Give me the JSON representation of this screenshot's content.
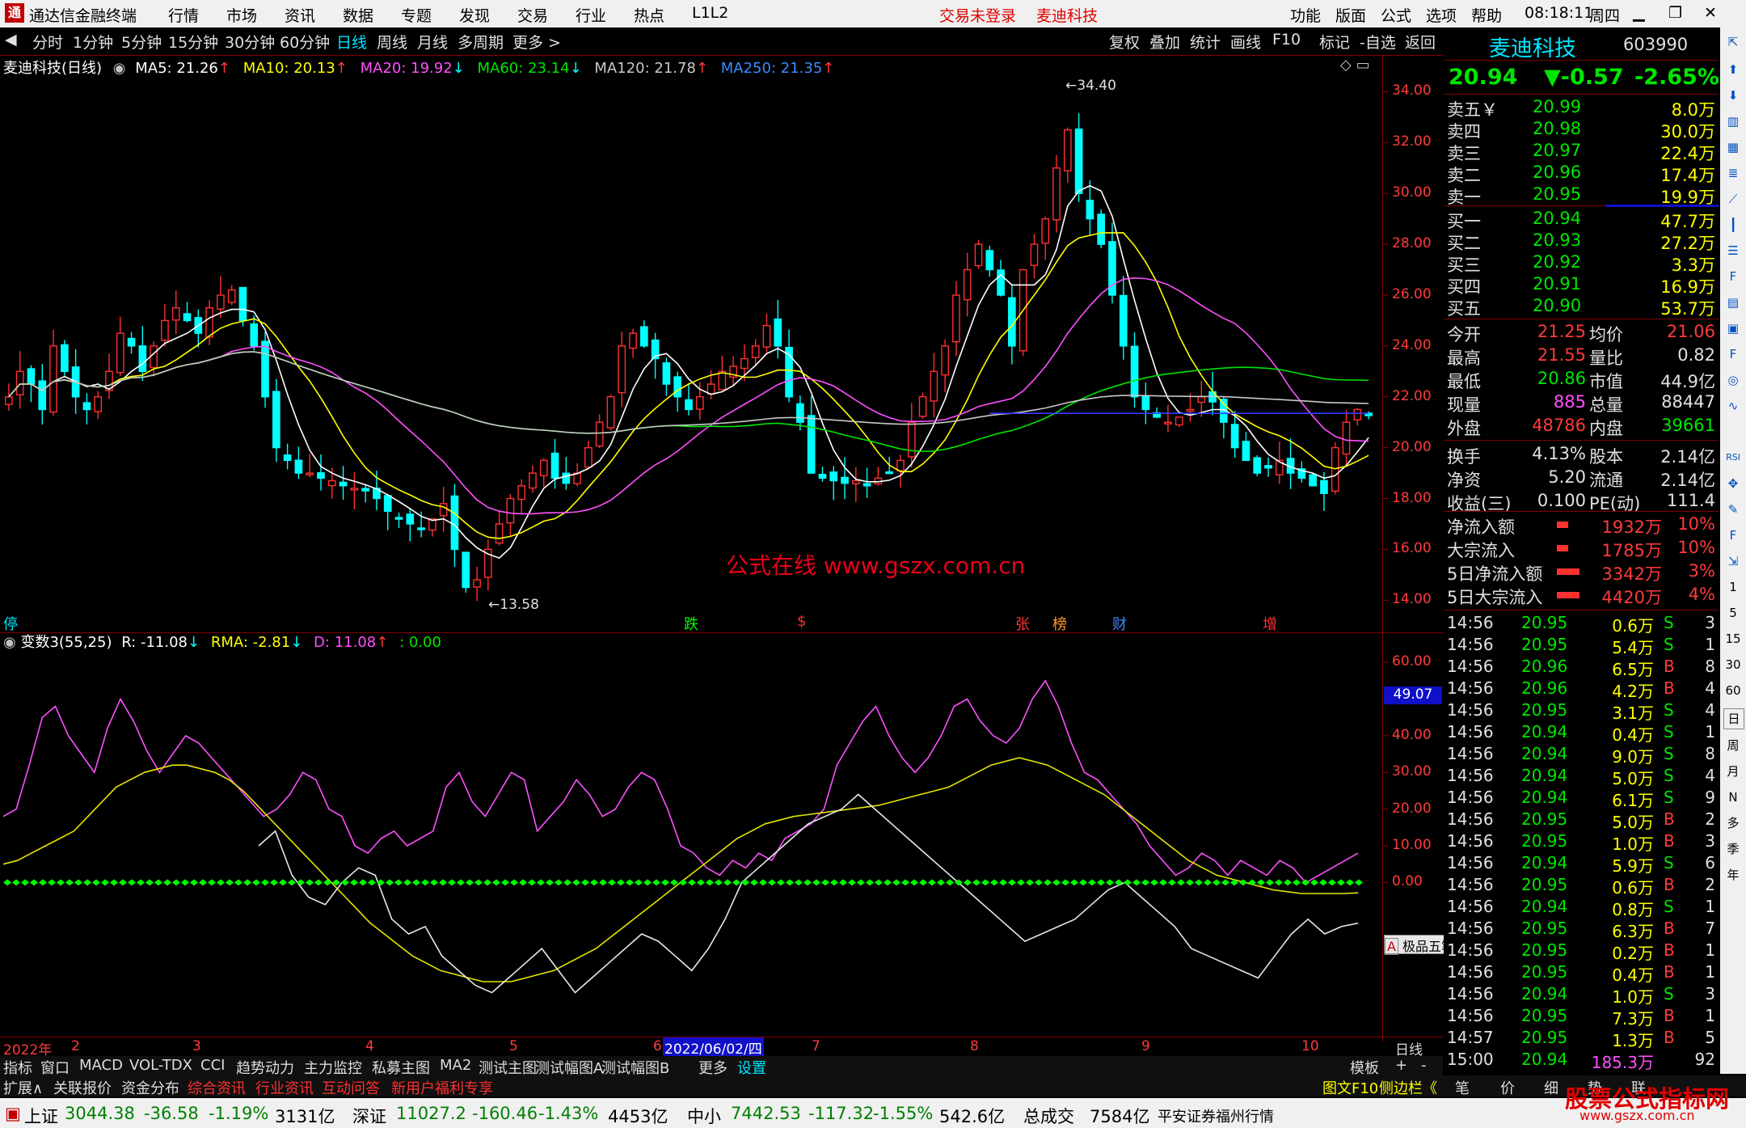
{
  "app": {
    "title": "通达信金融终端",
    "menu": [
      "行情",
      "市场",
      "资讯",
      "数据",
      "专题",
      "发现",
      "交易",
      "行业",
      "热点",
      "L1L2"
    ],
    "notice": [
      "交易未登录",
      "麦迪科技"
    ],
    "right_menu": [
      "功能",
      "版面",
      "公式",
      "选项",
      "帮助"
    ],
    "clock": "08:18:11",
    "weekday": "周四"
  },
  "toolbar": {
    "periods": [
      "分时",
      "1分钟",
      "5分钟",
      "15分钟",
      "30分钟",
      "60分钟",
      "日线",
      "周线",
      "月线",
      "多周期",
      "更多 >"
    ],
    "actions": [
      "复权",
      "叠加",
      "统计",
      "画线",
      "F10",
      "标记",
      "-自选",
      "返回"
    ]
  },
  "ma_header": {
    "name": "麦迪科技(日线)",
    "ma5": "MA5: 21.26",
    "ma10": "MA10: 20.13",
    "ma20": "MA20: 19.92",
    "ma60": "MA60: 23.14",
    "ma120": "MA120: 21.78",
    "ma250": "MA250: 21.35"
  },
  "indicator_header": {
    "name": "变数3(55,25)",
    "r": "R: -11.08",
    "rma": "RMA: -2.81",
    "d": "D: 11.08",
    "z": ": 0.00"
  },
  "watermark": "公式在线 www.gszx.com.cn",
  "price_labels": {
    "high": "34.40",
    "low": "13.58"
  },
  "event_marks": [
    "停",
    "跌",
    "$",
    "张",
    "榜",
    "财",
    "增"
  ],
  "date_axis": {
    "year": "2022年",
    "months": [
      "2",
      "3",
      "4",
      "5",
      "6",
      "7",
      "8",
      "9",
      "10"
    ],
    "cursor": "2022/06/02/四",
    "period": "日线"
  },
  "float_toolbar": "极品五笔",
  "chart_data": [
    {
      "type": "candlestick",
      "y_axis": [
        "34.00",
        "32.00",
        "30.00",
        "28.00",
        "26.00",
        "24.00",
        "22.00",
        "20.00",
        "18.00",
        "16.00",
        "14.00"
      ],
      "ylim": [
        13.5,
        35.0
      ],
      "close": [
        22,
        23,
        22.5,
        21.5,
        24,
        23,
        22,
        21.5,
        22,
        23,
        24.5,
        24,
        23,
        24,
        25,
        25.5,
        25,
        24.5,
        25.5,
        26,
        26.2,
        25,
        24,
        22,
        20,
        19.5,
        19,
        19,
        18.8,
        18.7,
        18.5,
        18.4,
        18.3,
        18,
        17.5,
        17.2,
        17,
        16.8,
        17.2,
        17.8,
        16,
        14.5,
        14.8,
        16,
        17,
        18,
        18.5,
        19,
        19.5,
        18.8,
        18.6,
        19,
        20,
        21,
        22,
        24,
        24.5,
        24,
        23.5,
        22.5,
        22,
        21.5,
        22,
        22.5,
        23,
        23.2,
        23.5,
        24,
        24.8,
        24,
        22,
        21,
        19,
        18.8,
        18.7,
        18.6,
        18.7,
        18.5,
        18.8,
        19,
        19.5,
        21,
        22,
        23,
        24,
        26,
        27,
        28,
        27,
        26,
        24,
        27,
        28,
        29,
        31,
        32.5,
        30,
        29,
        28,
        26,
        24,
        22,
        21.5,
        21.2,
        21,
        21.2,
        21.5,
        22,
        21.8,
        21,
        20,
        19.5,
        19,
        19.2,
        19.5,
        19,
        18.8,
        18.5,
        18.2,
        20,
        21,
        21.5,
        21.26
      ],
      "ma5": "MA5",
      "ma10": "MA10",
      "ma20": "MA20",
      "ma60": "MA60",
      "ma120": "MA120"
    },
    {
      "type": "line",
      "y_axis": [
        "60.00",
        "50.00",
        "40.00",
        "30.00",
        "20.00",
        "10.00",
        "0.00"
      ],
      "ylim": [
        -40,
        62
      ],
      "current_label": "49.07",
      "series": [
        {
          "name": "D",
          "values": [
            18,
            20,
            32,
            45,
            48,
            40,
            35,
            30,
            42,
            50,
            44,
            36,
            30,
            35,
            40,
            38,
            34,
            30,
            26,
            22,
            18,
            20,
            24,
            30,
            28,
            20,
            18,
            10,
            8,
            12,
            14,
            10,
            12,
            14,
            26,
            30,
            22,
            18,
            24,
            30,
            28,
            14,
            18,
            22,
            28,
            24,
            18,
            20,
            26,
            30,
            28,
            20,
            10,
            8,
            4,
            2,
            6,
            4,
            8,
            6,
            12,
            14,
            16,
            20,
            32,
            38,
            44,
            48,
            40,
            34,
            30,
            34,
            40,
            48,
            50,
            44,
            40,
            38,
            42,
            50,
            55,
            48,
            38,
            30,
            28,
            24,
            20,
            16,
            10,
            6,
            2,
            4,
            8,
            6,
            2,
            6,
            4,
            2,
            6,
            4,
            0,
            2,
            4,
            6,
            8
          ]
        },
        {
          "name": "RMA",
          "values": [
            5,
            6,
            8,
            10,
            12,
            14,
            18,
            22,
            26,
            28,
            30,
            31,
            32,
            32,
            31,
            30,
            28,
            25,
            21,
            17,
            13,
            9,
            5,
            1,
            -3,
            -7,
            -11,
            -14,
            -17,
            -20,
            -22,
            -24,
            -25,
            -26,
            -27,
            -27,
            -27,
            -26,
            -25,
            -24,
            -22,
            -20,
            -18,
            -15,
            -12,
            -9,
            -6,
            -3,
            0,
            3,
            6,
            9,
            12,
            14,
            16,
            17,
            18,
            18.5,
            19,
            19.5,
            20,
            20.5,
            21,
            22,
            23,
            24,
            25,
            26,
            28,
            30,
            32,
            33,
            34,
            33,
            32,
            30,
            28,
            26,
            24,
            21,
            18,
            15,
            12,
            9,
            6,
            4,
            2,
            1,
            0,
            -1,
            -2,
            -2.5,
            -3,
            -3,
            -3,
            -3,
            -2.81
          ]
        },
        {
          "name": "R",
          "values": [
            10,
            14,
            2,
            -4,
            -6,
            0,
            4,
            2,
            -10,
            -14,
            -12,
            -20,
            -24,
            -28,
            -30,
            -26,
            -22,
            -18,
            -24,
            -30,
            -26,
            -22,
            -18,
            -14,
            -16,
            -20,
            -24,
            -18,
            -10,
            0,
            4,
            8,
            12,
            16,
            18,
            20,
            24,
            20,
            16,
            12,
            8,
            4,
            0,
            -4,
            -8,
            -12,
            -16,
            -14,
            -12,
            -10,
            -6,
            -2,
            0,
            -4,
            -8,
            -12,
            -18,
            -20,
            -22,
            -24,
            -26,
            -20,
            -14,
            -10,
            -14,
            -12,
            -11.08
          ]
        },
        {
          "name": "Z",
          "values": [
            0,
            0
          ]
        }
      ]
    }
  ],
  "quote": {
    "name": "麦迪科技",
    "code": "603990",
    "price": "20.94",
    "change": "▼-0.57",
    "pct": "-2.65%",
    "asks": [
      [
        "卖五￥",
        "20.99",
        "8.0万"
      ],
      [
        "卖四",
        "20.98",
        "30.0万"
      ],
      [
        "卖三",
        "20.97",
        "22.4万"
      ],
      [
        "卖二",
        "20.96",
        "17.4万"
      ],
      [
        "卖一",
        "20.95",
        "19.9万"
      ]
    ],
    "bids": [
      [
        "买一",
        "20.94",
        "47.7万"
      ],
      [
        "买二",
        "20.93",
        "27.2万"
      ],
      [
        "买三",
        "20.92",
        "3.3万"
      ],
      [
        "买四",
        "20.91",
        "16.9万"
      ],
      [
        "买五",
        "20.90",
        "53.7万"
      ]
    ],
    "stats": [
      [
        "今开",
        "21.25",
        "均价",
        "21.06"
      ],
      [
        "最高",
        "21.55",
        "量比",
        "0.82"
      ],
      [
        "最低",
        "20.86",
        "市值",
        "44.9亿"
      ],
      [
        "现量",
        "885",
        "总量",
        "88447"
      ],
      [
        "外盘",
        "48786",
        "内盘",
        "39661"
      ],
      [
        "换手",
        "4.13%",
        "股本",
        "2.14亿"
      ],
      [
        "净资",
        "5.20",
        "流通",
        "2.14亿"
      ],
      [
        "收益(三)",
        "0.100",
        "PE(动)",
        "111.4"
      ]
    ],
    "flows": [
      [
        "净流入额",
        "1932万",
        "10%"
      ],
      [
        "大宗流入",
        "1785万",
        "10%"
      ],
      [
        "5日净流入额",
        "3342万",
        "3%"
      ],
      [
        "5日大宗流入",
        "4420万",
        "4%"
      ]
    ],
    "ticks": [
      [
        "14:56",
        "20.95",
        "0.6万",
        "S",
        "3"
      ],
      [
        "14:56",
        "20.95",
        "5.4万",
        "S",
        "1"
      ],
      [
        "14:56",
        "20.96",
        "6.5万",
        "B",
        "8"
      ],
      [
        "14:56",
        "20.96",
        "4.2万",
        "B",
        "4"
      ],
      [
        "14:56",
        "20.95",
        "3.1万",
        "S",
        "4"
      ],
      [
        "14:56",
        "20.94",
        "0.4万",
        "S",
        "1"
      ],
      [
        "14:56",
        "20.94",
        "9.0万",
        "S",
        "8"
      ],
      [
        "14:56",
        "20.94",
        "5.0万",
        "S",
        "4"
      ],
      [
        "14:56",
        "20.94",
        "6.1万",
        "S",
        "9"
      ],
      [
        "14:56",
        "20.95",
        "5.0万",
        "B",
        "2"
      ],
      [
        "14:56",
        "20.95",
        "1.0万",
        "B",
        "3"
      ],
      [
        "14:56",
        "20.94",
        "5.9万",
        "S",
        "6"
      ],
      [
        "14:56",
        "20.95",
        "0.6万",
        "B",
        "2"
      ],
      [
        "14:56",
        "20.94",
        "0.8万",
        "S",
        "1"
      ],
      [
        "14:56",
        "20.95",
        "6.3万",
        "B",
        "7"
      ],
      [
        "14:56",
        "20.95",
        "0.2万",
        "B",
        "1"
      ],
      [
        "14:56",
        "20.95",
        "0.4万",
        "B",
        "1"
      ],
      [
        "14:56",
        "20.94",
        "1.0万",
        "S",
        "3"
      ],
      [
        "14:56",
        "20.95",
        "7.3万",
        "B",
        "1"
      ],
      [
        "14:57",
        "20.95",
        "1.3万",
        "B",
        "5"
      ],
      [
        "15:00",
        "20.94",
        "185.3万",
        "",
        "92"
      ]
    ]
  },
  "tabs1": [
    "指标",
    "窗口",
    "MACD",
    "VOL-TDX",
    "CCI",
    "趋势动力",
    "主力监控",
    "私募主图",
    "MA2",
    "测试主图",
    "测试幅图A",
    "测试幅图B",
    "更多",
    "设置",
    "模板",
    "+",
    "-"
  ],
  "tabs2": [
    "扩展∧",
    "关联报价",
    "资金分布",
    "综合资讯",
    "行业资讯",
    "互动问答",
    "新用户福利专享",
    "图文F10",
    "侧边栏《",
    "笔",
    "价",
    "细",
    "势",
    "联"
  ],
  "status": {
    "sh": "上证",
    "sh_v": "3044.38",
    "sh_c": "-36.58",
    "sh_p": "-1.19%",
    "sh_a": "3131亿",
    "sz": "深证",
    "sz_v": "11027.2",
    "sz_c": "-160.46",
    "sz_p": "-1.43%",
    "sz_a": "4453亿",
    "zx": "中小",
    "zx_v": "7442.53",
    "zx_c": "-117.32",
    "zx_p": "-1.55%",
    "zx_a": "542.6亿",
    "total": "总成交",
    "total_v": "7584亿",
    "broker": "平安证券福州行情",
    "brand": "股票公式指标网",
    "brand_url": "www.gszx.com.cn"
  }
}
